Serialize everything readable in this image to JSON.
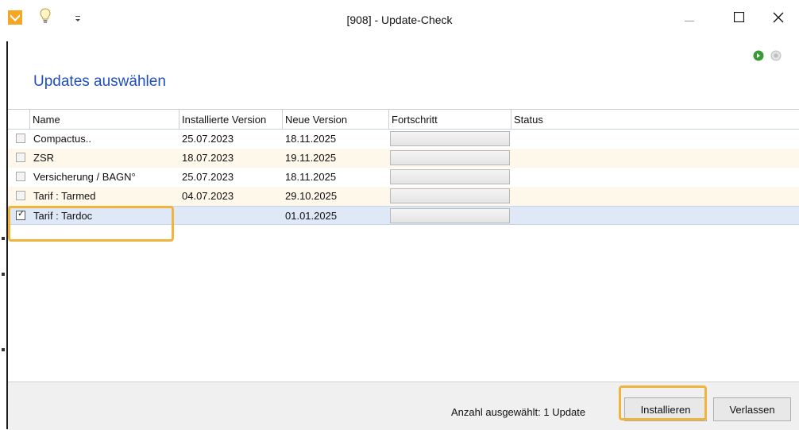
{
  "window": {
    "title": "[908] - Update-Check"
  },
  "page": {
    "heading": "Updates auswählen"
  },
  "table": {
    "columns": [
      "Name",
      "Installierte Version",
      "Neue Version",
      "Fortschritt",
      "Status"
    ],
    "rows": [
      {
        "name": "Compactus..",
        "installed": "25.07.2023",
        "new": "18.11.2025",
        "progress": "",
        "status": "",
        "checked": false
      },
      {
        "name": "ZSR",
        "installed": "18.07.2023",
        "new": "19.11.2025",
        "progress": "",
        "status": "",
        "checked": false
      },
      {
        "name": "Versicherung / BAGN°",
        "installed": "25.07.2023",
        "new": "18.11.2025",
        "progress": "",
        "status": "",
        "checked": false
      },
      {
        "name": "Tarif : Tarmed",
        "installed": "04.07.2023",
        "new": "29.10.2025",
        "progress": "",
        "status": "",
        "checked": false
      },
      {
        "name": "Tarif : Tardoc",
        "installed": "",
        "new": "01.01.2025",
        "progress": "",
        "status": "",
        "checked": true
      }
    ]
  },
  "footer": {
    "count_text": "Anzahl ausgewählt: 1 Update",
    "install_label": "Installieren",
    "exit_label": "Verlassen"
  },
  "icons": {
    "app": "app-logo-icon",
    "bulb": "lightbulb-icon",
    "quick_access": "quick-access-icon",
    "minimize": "minimize-icon",
    "maximize": "maximize-icon",
    "close": "close-icon",
    "forward": "forward-icon",
    "back": "back-icon"
  },
  "colors": {
    "heading": "#1f4fbf",
    "highlight": "#f0b43c",
    "selected_row": "#dfe8f7",
    "alt_row": "#fdf8ea",
    "app_logo": "#f5a623"
  }
}
